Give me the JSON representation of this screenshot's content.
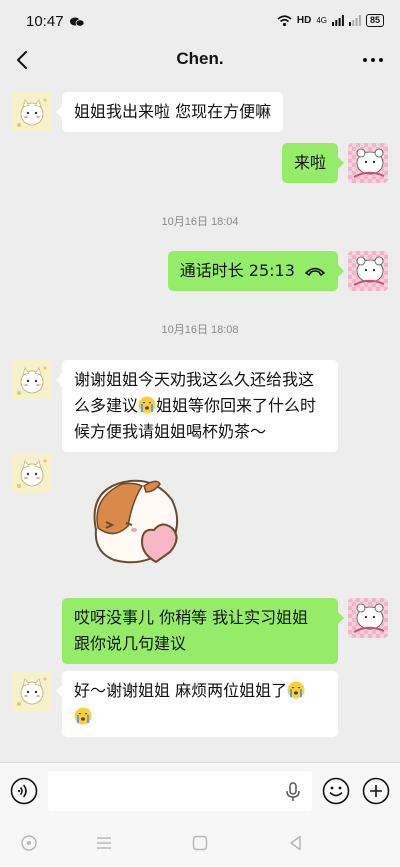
{
  "status_bar": {
    "time": "10:47",
    "network": "HD",
    "signal": "4G",
    "battery": "85"
  },
  "header": {
    "title": "Chen."
  },
  "messages": {
    "m1": {
      "text": "姐姐我出来啦 您现在方便嘛"
    },
    "m2": {
      "text": "来啦"
    },
    "ts1": "10月16日 18:04",
    "m3": {
      "text": "通话时长 25:13"
    },
    "ts2": "10月16日 18:08",
    "m4": {
      "line1": "谢谢姐姐今天劝我这么久还给我这",
      "line2a": "么多建议",
      "line2b": "姐姐等你回来了什么时",
      "line3": "候方便我请姐姐喝杯奶茶～"
    },
    "m6": {
      "line1": "哎呀没事儿 你稍等 我让实习姐姐",
      "line2": "跟你说几句建议"
    },
    "m7": {
      "line1": "好～谢谢姐姐 麻烦两位姐姐了"
    }
  },
  "colors": {
    "self_bubble": "#95ec69",
    "other_bubble": "#ffffff",
    "background": "#ededed"
  },
  "icons": [
    "back-icon",
    "more-icon",
    "voice-icon",
    "mic-icon",
    "emoji-icon",
    "plus-icon",
    "crying-emoji",
    "phone-icon"
  ]
}
